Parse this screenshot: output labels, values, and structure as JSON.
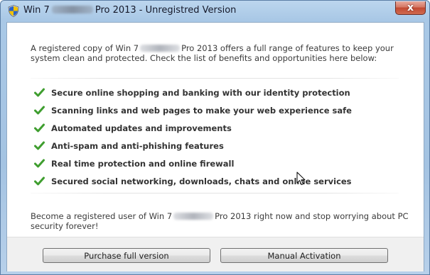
{
  "window": {
    "title_prefix": "Win 7",
    "title_suffix": "Pro 2013 - Unregistred Version",
    "close_label": "x"
  },
  "intro": {
    "part1": "A registered copy of Win 7",
    "part2": "Pro 2013 offers a full range of features to keep your system clean and protected. Check the list of benefits and opportunities here below:"
  },
  "features": [
    "Secure online shopping and banking with our identity protection",
    "Scanning links and web pages to make your web experience safe",
    "Automated updates and improvements",
    "Anti-spam and anti-phishing features",
    "Real time protection and online firewall",
    "Secured social networking, downloads, chats and online services"
  ],
  "outro": {
    "part1": "Become a registered user of Win 7",
    "part2": "Pro 2013 right now and stop worrying about PC security forever!"
  },
  "buttons": {
    "purchase": "Purchase full version",
    "activate": "Manual Activation"
  },
  "icons": {
    "title": "shield-icon",
    "feature_bullet": "checkmark-icon",
    "pointer": "mouse-cursor-icon"
  },
  "colors": {
    "check_green": "#3f9e2f",
    "close_red": "#c24a32",
    "titlebar_blue": "#a4c3e2"
  }
}
